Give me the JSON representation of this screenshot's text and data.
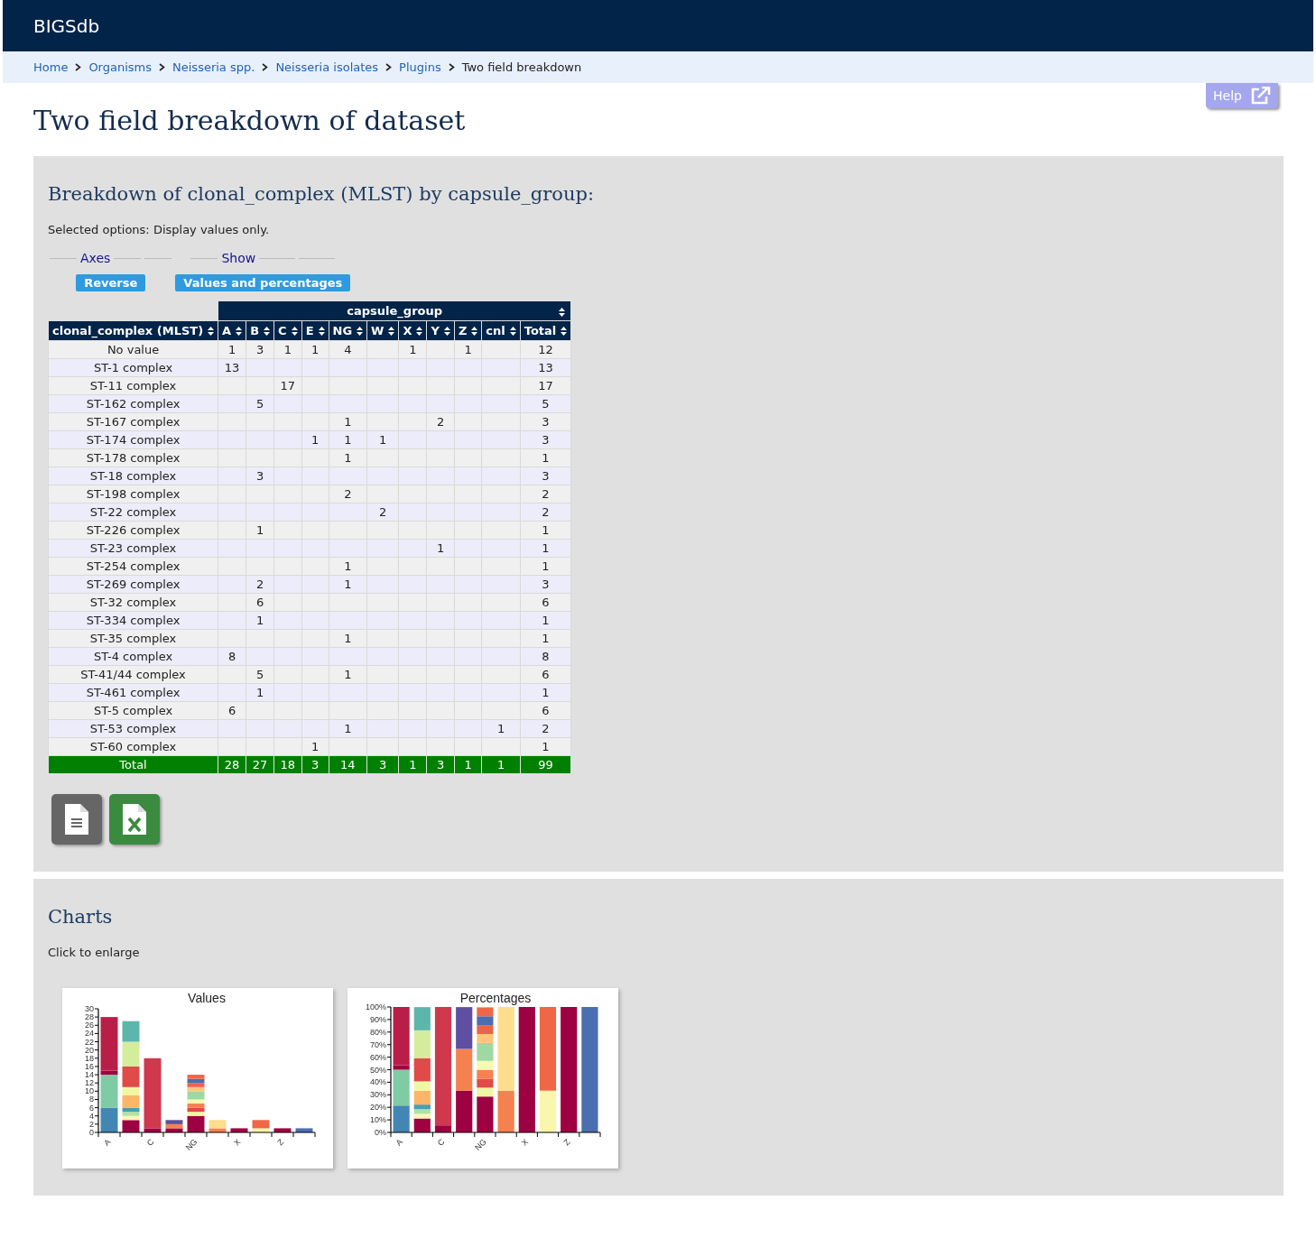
{
  "header": {
    "brand": "BIGSdb"
  },
  "breadcrumbs": [
    {
      "label": "Home"
    },
    {
      "label": "Organisms"
    },
    {
      "label": "Neisseria spp."
    },
    {
      "label": "Neisseria isolates"
    },
    {
      "label": "Plugins"
    },
    {
      "label": "Two field breakdown"
    }
  ],
  "help": {
    "label": "Help"
  },
  "title": "Two field breakdown of dataset",
  "breakdown": {
    "heading": "Breakdown of clonal_complex (MLST) by capsule_group:",
    "options": "Selected options: Display values only.",
    "controls": [
      {
        "legend": "Axes",
        "button": "Reverse"
      },
      {
        "legend": "Show",
        "button": "Values and percentages"
      }
    ],
    "table": {
      "group_header": "capsule_group",
      "row_header": "clonal_complex (MLST)",
      "columns": [
        "A",
        "B",
        "C",
        "E",
        "NG",
        "W",
        "X",
        "Y",
        "Z",
        "cnl",
        "Total"
      ],
      "rows": [
        {
          "label": "No value",
          "cells": [
            "1",
            "3",
            "1",
            "1",
            "4",
            null,
            "1",
            null,
            "1",
            null,
            "12"
          ]
        },
        {
          "label": "ST-1 complex",
          "cells": [
            "13",
            null,
            null,
            null,
            null,
            null,
            null,
            null,
            null,
            null,
            "13"
          ]
        },
        {
          "label": "ST-11 complex",
          "cells": [
            null,
            null,
            "17",
            null,
            null,
            null,
            null,
            null,
            null,
            null,
            "17"
          ]
        },
        {
          "label": "ST-162 complex",
          "cells": [
            null,
            "5",
            null,
            null,
            null,
            null,
            null,
            null,
            null,
            null,
            "5"
          ]
        },
        {
          "label": "ST-167 complex",
          "cells": [
            null,
            null,
            null,
            null,
            "1",
            null,
            null,
            "2",
            null,
            null,
            "3"
          ]
        },
        {
          "label": "ST-174 complex",
          "cells": [
            null,
            null,
            null,
            "1",
            "1",
            "1",
            null,
            null,
            null,
            null,
            "3"
          ]
        },
        {
          "label": "ST-178 complex",
          "cells": [
            null,
            null,
            null,
            null,
            "1",
            null,
            null,
            null,
            null,
            null,
            "1"
          ]
        },
        {
          "label": "ST-18 complex",
          "cells": [
            null,
            "3",
            null,
            null,
            null,
            null,
            null,
            null,
            null,
            null,
            "3"
          ]
        },
        {
          "label": "ST-198 complex",
          "cells": [
            null,
            null,
            null,
            null,
            "2",
            null,
            null,
            null,
            null,
            null,
            "2"
          ]
        },
        {
          "label": "ST-22 complex",
          "cells": [
            null,
            null,
            null,
            null,
            null,
            "2",
            null,
            null,
            null,
            null,
            "2"
          ]
        },
        {
          "label": "ST-226 complex",
          "cells": [
            null,
            "1",
            null,
            null,
            null,
            null,
            null,
            null,
            null,
            null,
            "1"
          ]
        },
        {
          "label": "ST-23 complex",
          "cells": [
            null,
            null,
            null,
            null,
            null,
            null,
            null,
            "1",
            null,
            null,
            "1"
          ]
        },
        {
          "label": "ST-254 complex",
          "cells": [
            null,
            null,
            null,
            null,
            "1",
            null,
            null,
            null,
            null,
            null,
            "1"
          ]
        },
        {
          "label": "ST-269 complex",
          "cells": [
            null,
            "2",
            null,
            null,
            "1",
            null,
            null,
            null,
            null,
            null,
            "3"
          ]
        },
        {
          "label": "ST-32 complex",
          "cells": [
            null,
            "6",
            null,
            null,
            null,
            null,
            null,
            null,
            null,
            null,
            "6"
          ]
        },
        {
          "label": "ST-334 complex",
          "cells": [
            null,
            "1",
            null,
            null,
            null,
            null,
            null,
            null,
            null,
            null,
            "1"
          ]
        },
        {
          "label": "ST-35 complex",
          "cells": [
            null,
            null,
            null,
            null,
            "1",
            null,
            null,
            null,
            null,
            null,
            "1"
          ]
        },
        {
          "label": "ST-4 complex",
          "cells": [
            "8",
            null,
            null,
            null,
            null,
            null,
            null,
            null,
            null,
            null,
            "8"
          ]
        },
        {
          "label": "ST-41/44 complex",
          "cells": [
            null,
            "5",
            null,
            null,
            "1",
            null,
            null,
            null,
            null,
            null,
            "6"
          ]
        },
        {
          "label": "ST-461 complex",
          "cells": [
            null,
            "1",
            null,
            null,
            null,
            null,
            null,
            null,
            null,
            null,
            "1"
          ]
        },
        {
          "label": "ST-5 complex",
          "cells": [
            "6",
            null,
            null,
            null,
            null,
            null,
            null,
            null,
            null,
            null,
            "6"
          ]
        },
        {
          "label": "ST-53 complex",
          "cells": [
            null,
            null,
            null,
            null,
            "1",
            null,
            null,
            null,
            null,
            "1",
            "2"
          ]
        },
        {
          "label": "ST-60 complex",
          "cells": [
            null,
            null,
            null,
            "1",
            null,
            null,
            null,
            null,
            null,
            null,
            "1"
          ]
        }
      ],
      "total": {
        "label": "Total",
        "cells": [
          "28",
          "27",
          "18",
          "3",
          "14",
          "3",
          "1",
          "3",
          "1",
          "1",
          "99"
        ]
      }
    }
  },
  "charts": {
    "heading": "Charts",
    "note": "Click to enlarge",
    "items": [
      {
        "chart_data": {
          "type": "bar",
          "title": "Values",
          "stacked": true,
          "categories": [
            "A",
            null,
            "C",
            null,
            "NG",
            null,
            "X",
            null,
            "Z",
            null
          ],
          "ylim": [
            0,
            30
          ],
          "yticks": [
            0,
            2,
            4,
            6,
            8,
            10,
            12,
            14,
            16,
            18,
            20,
            22,
            24,
            26,
            28,
            30
          ],
          "series": [
            {
              "color": "#4286b4",
              "values": [
                6,
                null,
                null,
                null,
                null,
                null,
                null,
                null,
                null,
                null
              ]
            },
            {
              "color": "#7ecba4",
              "values": [
                8,
                null,
                null,
                null,
                null,
                null,
                null,
                null,
                null,
                null
              ]
            },
            {
              "color": "#9e0142",
              "values": [
                1,
                3,
                1,
                1,
                4,
                null,
                1,
                null,
                1,
                null
              ]
            },
            {
              "color": "#b91e48",
              "values": [
                13,
                null,
                null,
                null,
                null,
                null,
                null,
                null,
                null,
                null
              ]
            },
            {
              "color": "#d0384e",
              "values": [
                null,
                null,
                17,
                null,
                null,
                null,
                null,
                null,
                null,
                null
              ]
            },
            {
              "color": "#fcf7b4",
              "values": [
                null,
                1,
                null,
                null,
                null,
                null,
                null,
                null,
                null,
                null
              ]
            },
            {
              "color": "#b5e0a3",
              "values": [
                null,
                1,
                null,
                null,
                null,
                null,
                null,
                null,
                null,
                null
              ]
            },
            {
              "color": "#479fb3",
              "values": [
                null,
                1,
                null,
                null,
                null,
                null,
                null,
                null,
                null,
                null
              ]
            },
            {
              "color": "#fdb567",
              "values": [
                null,
                3,
                null,
                null,
                null,
                null,
                null,
                null,
                null,
                null
              ]
            },
            {
              "color": "#eef8a2",
              "values": [
                null,
                2,
                null,
                null,
                1,
                null,
                null,
                null,
                null,
                null
              ]
            },
            {
              "color": "#e04b4a",
              "values": [
                null,
                5,
                null,
                null,
                1,
                null,
                null,
                null,
                null,
                null
              ]
            },
            {
              "color": "#d3ed9c",
              "values": [
                null,
                6,
                null,
                null,
                null,
                null,
                null,
                null,
                null,
                null
              ]
            },
            {
              "color": "#5db6ac",
              "values": [
                null,
                5,
                null,
                null,
                null,
                null,
                null,
                null,
                null,
                null
              ]
            },
            {
              "color": "#f68150",
              "values": [
                null,
                null,
                null,
                1,
                1,
                1,
                null,
                null,
                null,
                null
              ]
            },
            {
              "color": "#5e4fa2",
              "values": [
                null,
                null,
                null,
                1,
                null,
                null,
                null,
                null,
                null,
                null
              ]
            },
            {
              "color": "#f6fbb0",
              "values": [
                null,
                null,
                null,
                null,
                1,
                null,
                null,
                null,
                null,
                null
              ]
            },
            {
              "color": "#a0d8a4",
              "values": [
                null,
                null,
                null,
                null,
                2,
                null,
                null,
                null,
                null,
                null
              ]
            },
            {
              "color": "#fec779",
              "values": [
                null,
                null,
                null,
                null,
                1,
                null,
                null,
                null,
                null,
                null
              ]
            },
            {
              "color": "#ec6446",
              "values": [
                null,
                null,
                null,
                null,
                1,
                null,
                null,
                null,
                null,
                null
              ]
            },
            {
              "color": "#4a6eb0",
              "values": [
                null,
                null,
                null,
                null,
                1,
                null,
                null,
                null,
                null,
                1
              ]
            },
            {
              "color": "#fedd8d",
              "values": [
                null,
                null,
                null,
                null,
                null,
                2,
                null,
                null,
                null,
                null
              ]
            },
            {
              "color": "#fbf6ad",
              "values": [
                null,
                null,
                null,
                null,
                null,
                null,
                null,
                1,
                null,
                null
              ]
            },
            {
              "color": "#ef6746",
              "values": [
                null,
                null,
                null,
                null,
                1,
                null,
                null,
                2,
                null,
                null
              ]
            }
          ]
        }
      },
      {
        "chart_data": {
          "type": "bar",
          "title": "Percentages",
          "stacked": true,
          "categories": [
            "A",
            null,
            "C",
            null,
            "NG",
            null,
            "X",
            null,
            "Z",
            null
          ],
          "ylim": [
            0,
            100
          ],
          "yticks": [
            {
              "value": 0,
              "label": "0%"
            },
            {
              "value": 10,
              "label": "10%"
            },
            {
              "value": 20,
              "label": "20%"
            },
            {
              "value": 30,
              "label": "30%"
            },
            {
              "value": 40,
              "label": "40%"
            },
            {
              "value": 50,
              "label": "50%"
            },
            {
              "value": 60,
              "label": "60%"
            },
            {
              "value": 70,
              "label": "70%"
            },
            {
              "value": 80,
              "label": "80%"
            },
            {
              "value": 90,
              "label": "90%"
            },
            {
              "value": 100,
              "label": "100%"
            }
          ],
          "series": [
            {
              "color": "#4286b4",
              "values": [
                21.4,
                null,
                null,
                null,
                null,
                null,
                null,
                null,
                null,
                null
              ]
            },
            {
              "color": "#7ecba4",
              "values": [
                28.6,
                null,
                null,
                null,
                null,
                null,
                null,
                null,
                null,
                null
              ]
            },
            {
              "color": "#9e0142",
              "values": [
                3.6,
                11.1,
                5.6,
                33.3,
                28.6,
                null,
                100,
                null,
                100,
                null
              ]
            },
            {
              "color": "#b91e48",
              "values": [
                46.4,
                null,
                null,
                null,
                null,
                null,
                null,
                null,
                null,
                null
              ]
            },
            {
              "color": "#d0384e",
              "values": [
                null,
                null,
                94.4,
                null,
                null,
                null,
                null,
                null,
                null,
                null
              ]
            },
            {
              "color": "#fcf7b4",
              "values": [
                null,
                3.7,
                null,
                null,
                null,
                null,
                null,
                null,
                null,
                null
              ]
            },
            {
              "color": "#b5e0a3",
              "values": [
                null,
                3.7,
                null,
                null,
                null,
                null,
                null,
                null,
                null,
                null
              ]
            },
            {
              "color": "#479fb3",
              "values": [
                null,
                3.7,
                null,
                null,
                null,
                null,
                null,
                null,
                null,
                null
              ]
            },
            {
              "color": "#fdb567",
              "values": [
                null,
                11.1,
                null,
                null,
                null,
                null,
                null,
                null,
                null,
                null
              ]
            },
            {
              "color": "#eef8a2",
              "values": [
                null,
                7.4,
                null,
                null,
                7.1,
                null,
                null,
                null,
                null,
                null
              ]
            },
            {
              "color": "#e04b4a",
              "values": [
                null,
                18.5,
                null,
                null,
                7.1,
                null,
                null,
                null,
                null,
                null
              ]
            },
            {
              "color": "#d3ed9c",
              "values": [
                null,
                22.2,
                null,
                null,
                null,
                null,
                null,
                null,
                null,
                null
              ]
            },
            {
              "color": "#5db6ac",
              "values": [
                null,
                18.5,
                null,
                null,
                null,
                null,
                null,
                null,
                null,
                null
              ]
            },
            {
              "color": "#f68150",
              "values": [
                null,
                null,
                null,
                33.3,
                7.1,
                33.3,
                null,
                null,
                null,
                null
              ]
            },
            {
              "color": "#5e4fa2",
              "values": [
                null,
                null,
                null,
                33.3,
                null,
                null,
                null,
                null,
                null,
                null
              ]
            },
            {
              "color": "#f6fbb0",
              "values": [
                null,
                null,
                null,
                null,
                7.1,
                null,
                null,
                null,
                null,
                null
              ]
            },
            {
              "color": "#a0d8a4",
              "values": [
                null,
                null,
                null,
                null,
                14.3,
                null,
                null,
                null,
                null,
                null
              ]
            },
            {
              "color": "#fec779",
              "values": [
                null,
                null,
                null,
                null,
                7.1,
                null,
                null,
                null,
                null,
                null
              ]
            },
            {
              "color": "#ec6446",
              "values": [
                null,
                null,
                null,
                null,
                7.1,
                null,
                null,
                null,
                null,
                null
              ]
            },
            {
              "color": "#4a6eb0",
              "values": [
                null,
                null,
                null,
                null,
                7.1,
                null,
                null,
                null,
                null,
                100
              ]
            },
            {
              "color": "#fedd8d",
              "values": [
                null,
                null,
                null,
                null,
                null,
                66.7,
                null,
                null,
                null,
                null
              ]
            },
            {
              "color": "#fbf6ad",
              "values": [
                null,
                null,
                null,
                null,
                null,
                null,
                null,
                33.3,
                null,
                null
              ]
            },
            {
              "color": "#ef6746",
              "values": [
                null,
                null,
                null,
                null,
                7.1,
                null,
                null,
                66.7,
                null,
                null
              ]
            }
          ]
        }
      }
    ]
  }
}
